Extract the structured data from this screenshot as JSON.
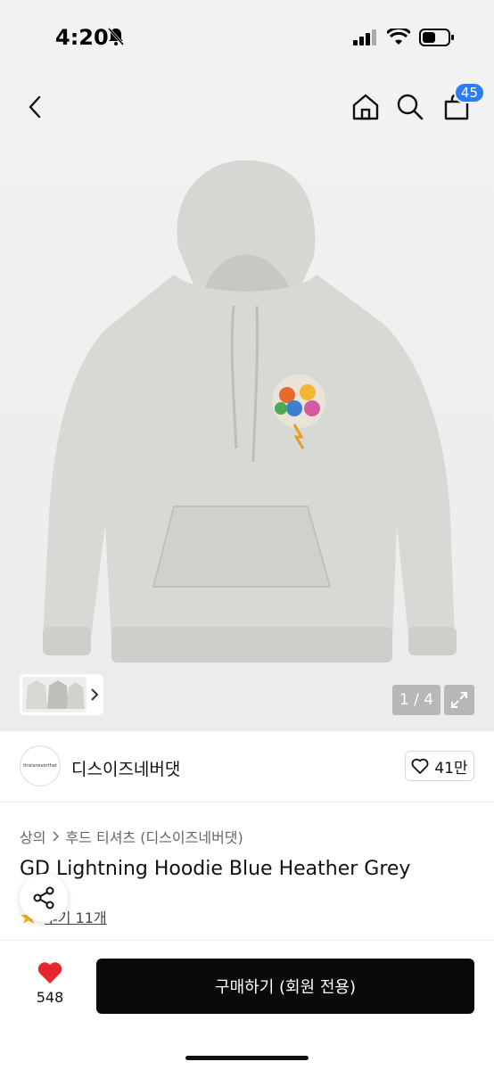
{
  "status": {
    "time": "4:20"
  },
  "header": {
    "cart_count": "45"
  },
  "gallery": {
    "page_indicator": "1 / 4"
  },
  "brand": {
    "logo_text": "thisisneverthat",
    "name": "디스이즈네버댓",
    "likes": "41만"
  },
  "product": {
    "breadcrumb_category": "상의",
    "breadcrumb_subcategory": "후드 티셔츠 (디스이즈네버댓)",
    "title": "GD Lightning Hoodie Blue Heather Grey",
    "review_text": "후기 11개"
  },
  "footer": {
    "like_count": "548",
    "buy_label": "구매하기 (회원 전용)"
  },
  "colors": {
    "accent_badge": "#2e7cf6",
    "heart": "#e8262f",
    "buy_button": "#0a0a0a"
  }
}
